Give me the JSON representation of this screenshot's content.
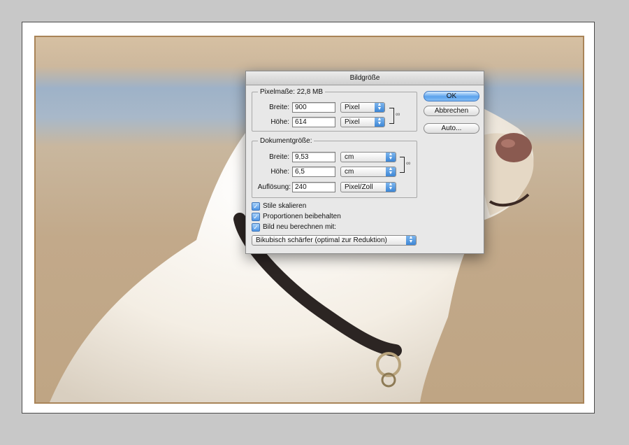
{
  "dialog": {
    "title": "Bildgröße",
    "pixel_dimensions": {
      "legend": "Pixelmaße: 22,8 MB",
      "width_label": "Breite:",
      "width_value": "900",
      "width_unit": "Pixel",
      "height_label": "Höhe:",
      "height_value": "614",
      "height_unit": "Pixel"
    },
    "document_size": {
      "legend": "Dokumentgröße:",
      "width_label": "Breite:",
      "width_value": "9,53",
      "width_unit": "cm",
      "height_label": "Höhe:",
      "height_value": "6,5",
      "height_unit": "cm",
      "resolution_label": "Auflösung:",
      "resolution_value": "240",
      "resolution_unit": "Pixel/Zoll"
    },
    "buttons": {
      "ok": "OK",
      "cancel": "Abbrechen",
      "auto": "Auto..."
    },
    "checkboxes": {
      "scale_styles": "Stile skalieren",
      "constrain_proportions": "Proportionen beibehalten",
      "resample": "Bild neu berechnen mit:"
    },
    "resample_method": "Bikubisch schärfer (optimal zur Reduktion)"
  },
  "colors": {
    "frame": "#a98458",
    "accent": "#5aa1ec"
  }
}
